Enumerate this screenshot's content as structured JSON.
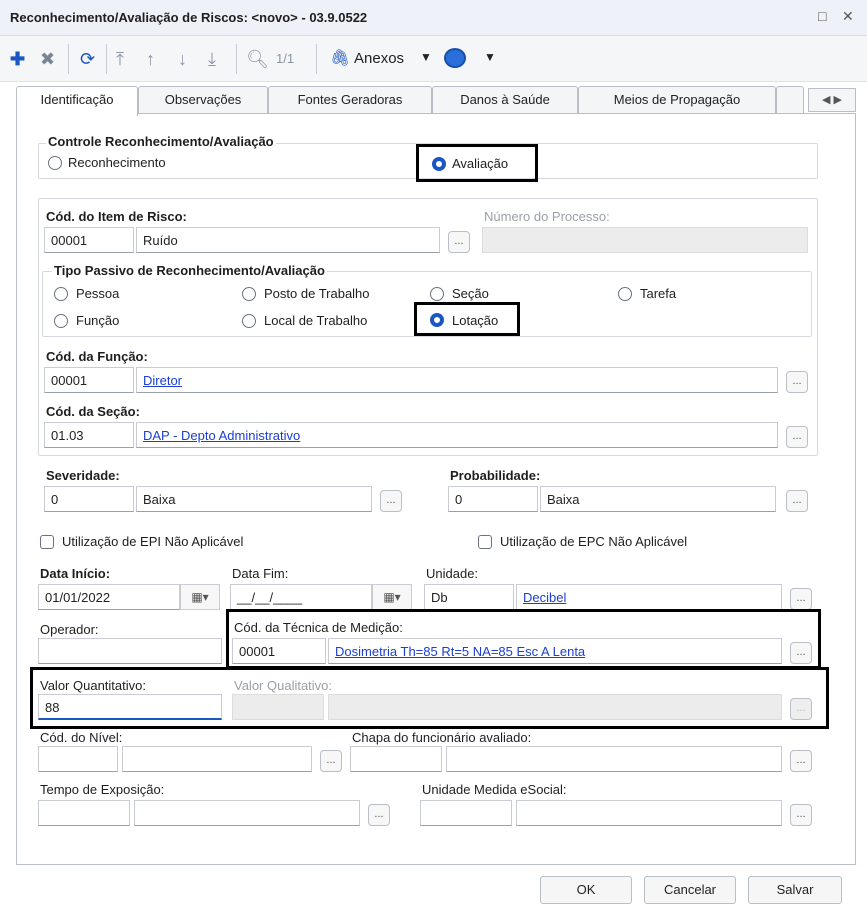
{
  "window": {
    "title": "Reconhecimento/Avaliação de Riscos: <novo> - 03.9.0522",
    "restore_icon": "□",
    "close_icon": "✕"
  },
  "toolbar": {
    "record_counter": "1/1",
    "attachments_label": "Anexos"
  },
  "tabs": [
    "Identificação",
    "Observações",
    "Fontes Geradoras",
    "Danos à Saúde",
    "Meios de Propagação"
  ],
  "controle": {
    "title": "Controle Reconhecimento/Avaliação",
    "option_reconhecimento": "Reconhecimento",
    "option_avaliacao": "Avaliação",
    "selected": "Avaliação"
  },
  "item_risco": {
    "label": "Cód. do Item de Risco:",
    "code": "00001",
    "name": "Ruído",
    "processo_label": "Número do Processo:",
    "processo_value": ""
  },
  "tipo_passivo": {
    "title": "Tipo Passivo de Reconhecimento/Avaliação",
    "pessoa": "Pessoa",
    "posto": "Posto de Trabalho",
    "secao": "Seção",
    "tarefa": "Tarefa",
    "funcao": "Função",
    "local": "Local de Trabalho",
    "lotacao": "Lotação",
    "selected": "Lotação"
  },
  "funcao": {
    "label": "Cód. da Função:",
    "code": "00001",
    "name": "Diretor"
  },
  "secao": {
    "label": "Cód. da Seção:",
    "code": "01.03",
    "name": "DAP - Depto Administrativo"
  },
  "severidade": {
    "label": "Severidade:",
    "code": "0",
    "name": "Baixa"
  },
  "probabilidade": {
    "label": "Probabilidade:",
    "code": "0",
    "name": "Baixa"
  },
  "epi": {
    "label": "Utilização de EPI Não Aplicável",
    "checked": false
  },
  "epc": {
    "label": "Utilização de EPC Não Aplicável",
    "checked": false
  },
  "datas": {
    "inicio_label": "Data Início:",
    "inicio_value": "01/01/2022",
    "fim_label": "Data Fim:",
    "fim_value": "__/__/____"
  },
  "unidade": {
    "label": "Unidade:",
    "code": "Db",
    "name": "Decibel"
  },
  "operador": {
    "label": "Operador:",
    "value": ""
  },
  "tecnica": {
    "label": "Cód. da Técnica de Medição:",
    "code": "00001",
    "name": "Dosimetria Th=85 Rt=5 NA=85 Esc A Lenta"
  },
  "valor_quantitativo": {
    "label": "Valor Quantitativo:",
    "value": "88"
  },
  "valor_qualitativo": {
    "label": "Valor Qualitativo:",
    "value": ""
  },
  "nivel": {
    "label": "Cód. do Nível:"
  },
  "chapa": {
    "label": "Chapa do funcionário avaliado:"
  },
  "tempo": {
    "label": "Tempo de Exposição:"
  },
  "unidade_esocial": {
    "label": "Unidade Medida eSocial:"
  },
  "lookup_button": "...",
  "buttons": {
    "ok": "OK",
    "cancel": "Cancelar",
    "save": "Salvar"
  },
  "colors": {
    "accent": "#1a56c4",
    "link": "#1a3fd1",
    "highlight": "#000000"
  }
}
